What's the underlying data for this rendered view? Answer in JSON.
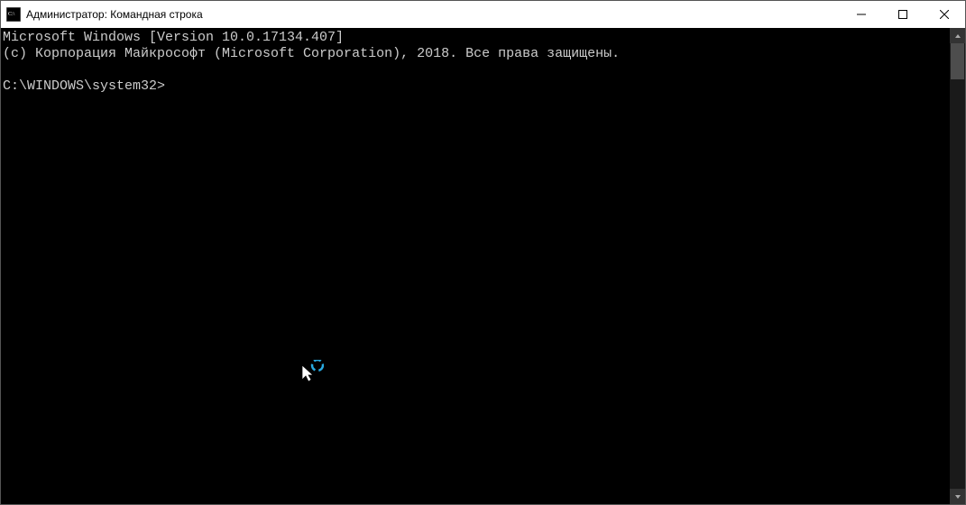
{
  "window": {
    "title": "Администратор: Командная строка"
  },
  "terminal": {
    "line1": "Microsoft Windows [Version 10.0.17134.407]",
    "line2": "(c) Корпорация Майкрософт (Microsoft Corporation), 2018. Все права защищены.",
    "blank": "",
    "prompt": "C:\\WINDOWS\\system32>"
  },
  "icons": {
    "app": "cmd-icon",
    "minimize": "minimize-icon",
    "maximize": "maximize-icon",
    "close": "close-icon",
    "scrollUp": "scroll-up-icon",
    "scrollDown": "scroll-down-icon",
    "cursor": "busy-cursor-icon"
  }
}
